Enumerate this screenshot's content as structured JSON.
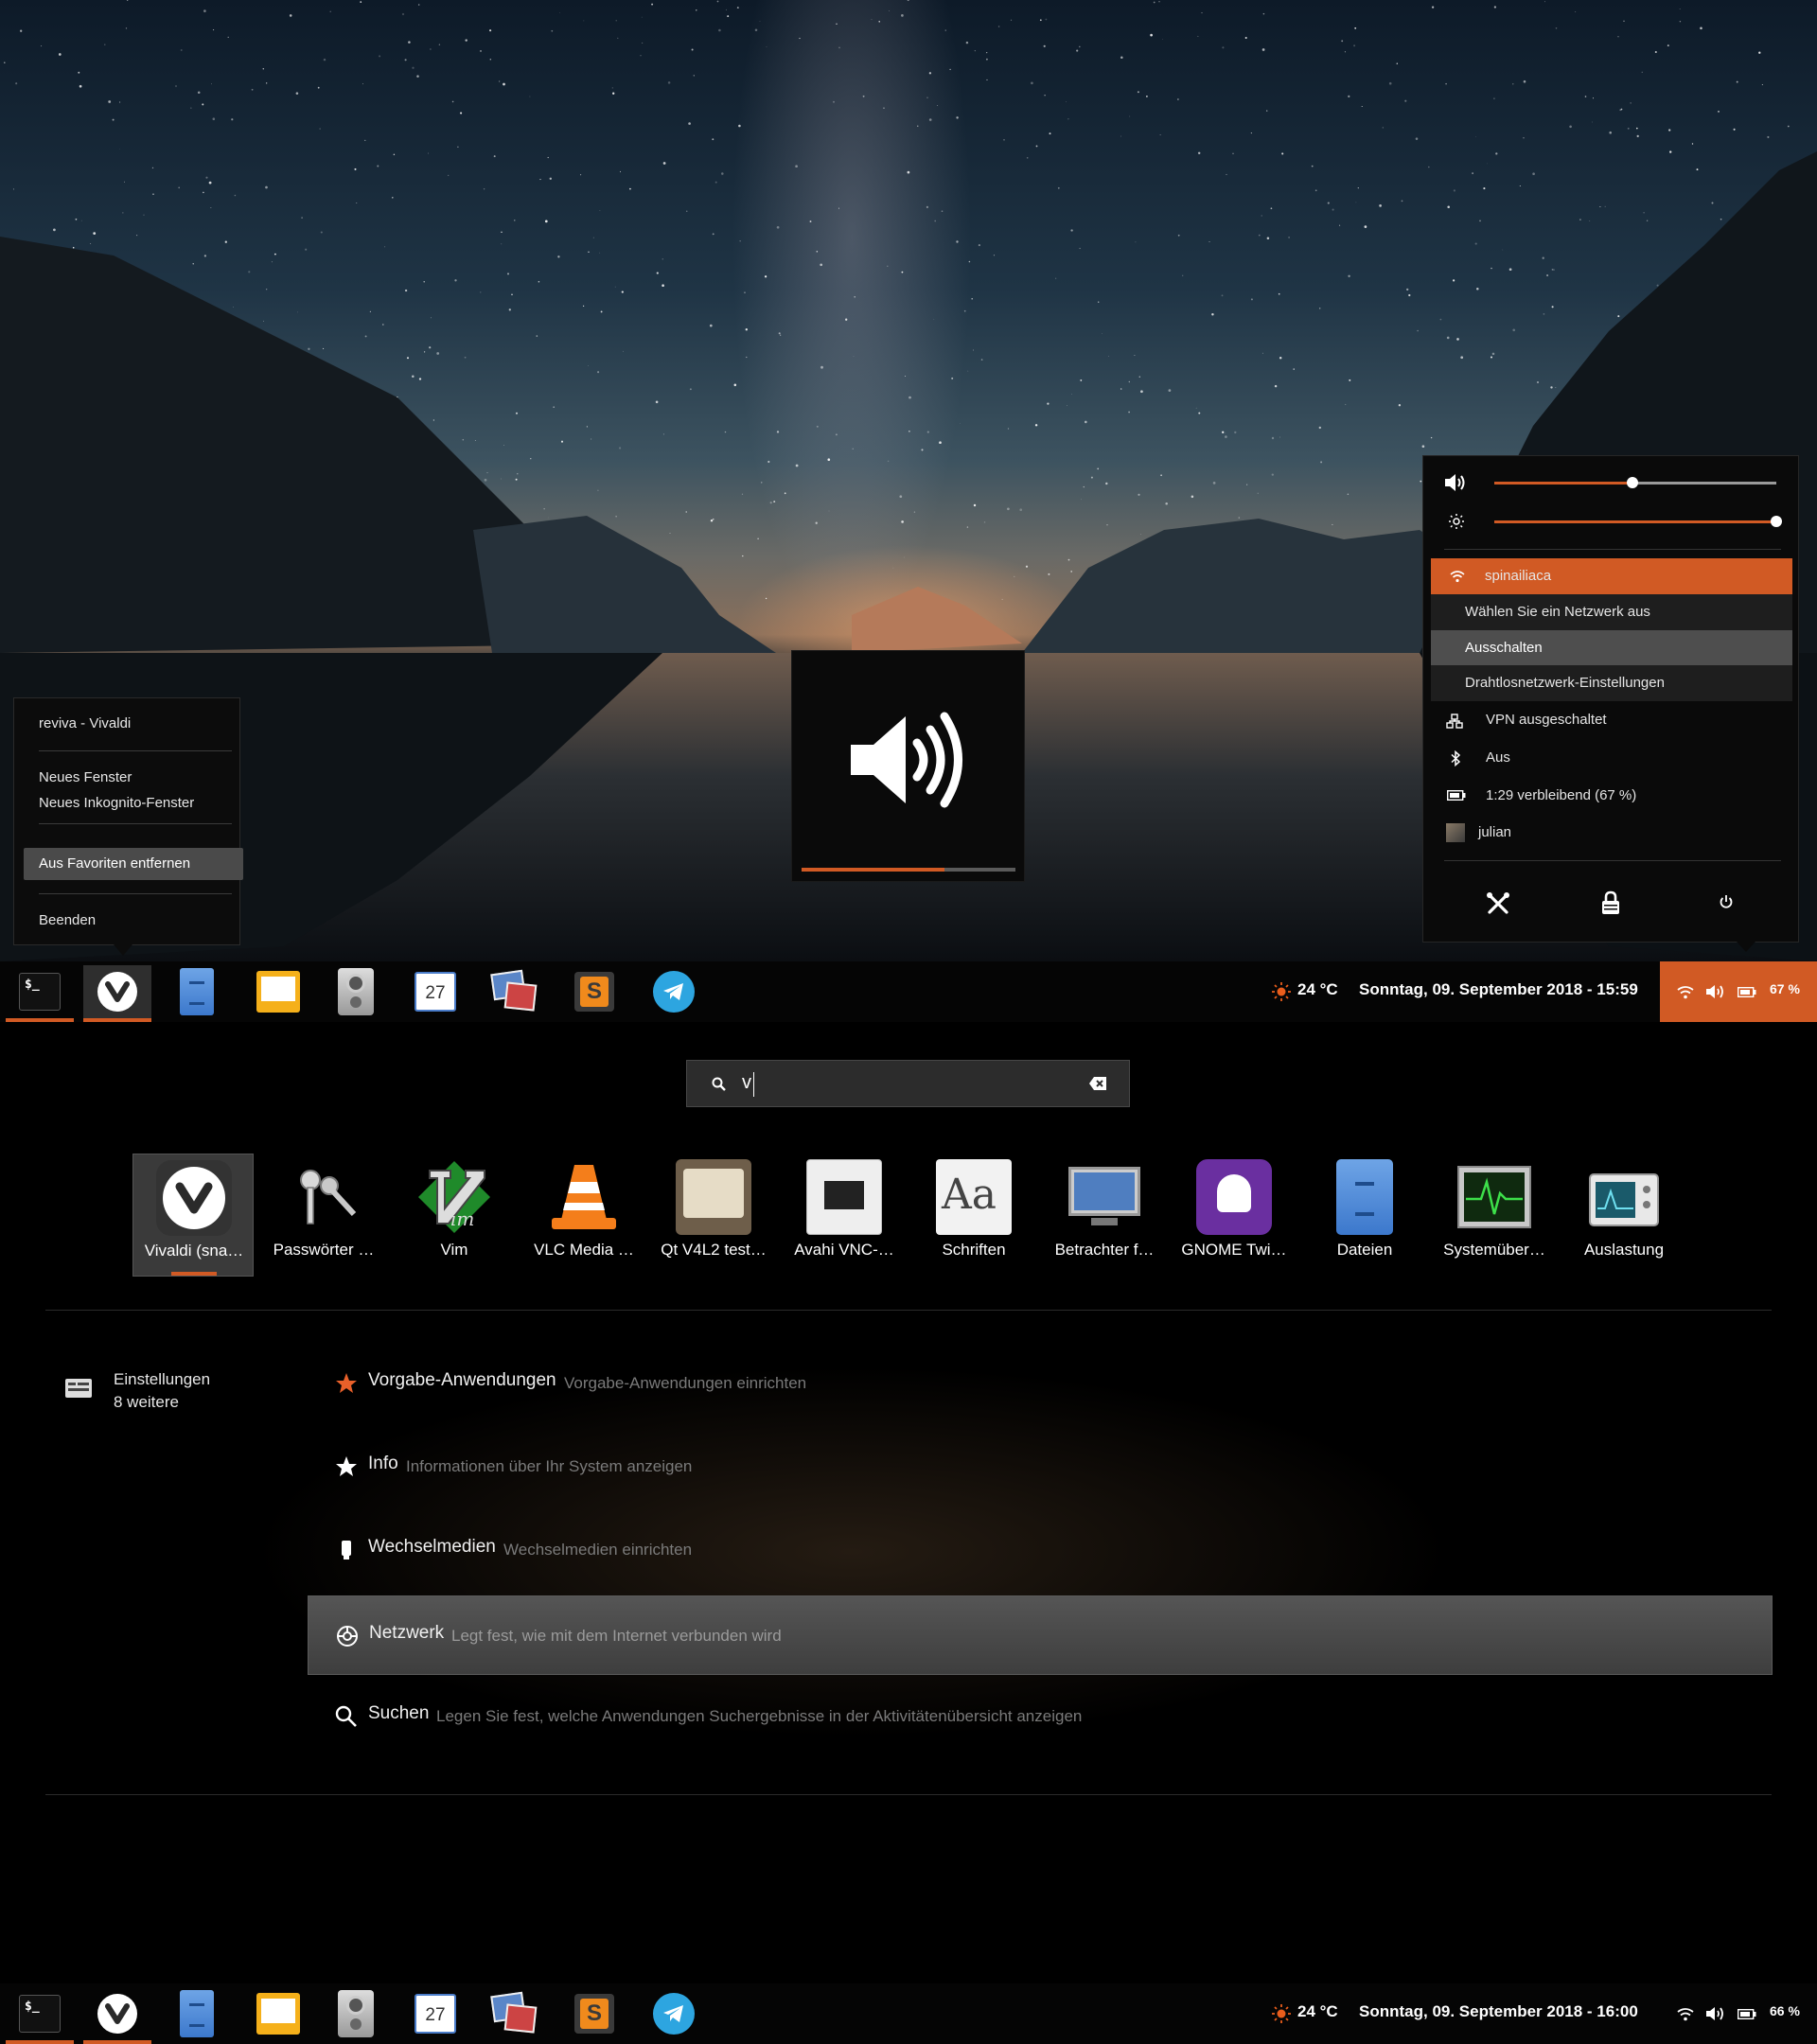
{
  "colors": {
    "accent": "#d15a24",
    "panel_bg": "#050505",
    "menu_bg": "#0a0a0a"
  },
  "desktop": {
    "vivaldi_menu": {
      "title": "reviva - Vivaldi",
      "items": [
        "Neues Fenster",
        "Neues Inkognito-Fenster"
      ],
      "highlighted": "Aus Favoriten entfernen",
      "quit": "Beenden"
    },
    "osd": {
      "icon": "speaker-volume-high-icon",
      "level": 0.67
    },
    "system_menu": {
      "volume_level": 0.49,
      "brightness_level": 1.0,
      "wifi": {
        "network": "spinailiaca",
        "items": [
          "Wählen Sie ein Netzwerk aus",
          "Ausschalten",
          "Drahtlosnetzwerk-Einstellungen"
        ]
      },
      "vpn": "VPN ausgeschaltet",
      "bluetooth": "Aus",
      "battery": "1:29 verbleibend (67 %)",
      "user": "julian",
      "actions": [
        "settings-icon",
        "lock-icon",
        "power-icon"
      ]
    }
  },
  "taskbar_top": {
    "apps": [
      "terminal",
      "vivaldi",
      "files",
      "slides",
      "speaker",
      "calendar",
      "image-viewer",
      "sublime",
      "telegram"
    ],
    "calendar_day": "27",
    "weather": "24 °C",
    "clock": "Sonntag, 09. September 2018 - 15:59",
    "battery_pct": "67 %"
  },
  "overview": {
    "search_value": "v",
    "apps": [
      {
        "name": "Vivaldi (sna…",
        "icon": "vivaldi-icon"
      },
      {
        "name": "Passwörter …",
        "icon": "keys-icon"
      },
      {
        "name": "Vim",
        "icon": "vim-icon"
      },
      {
        "name": "VLC Media …",
        "icon": "vlc-icon"
      },
      {
        "name": "Qt V4L2 test…",
        "icon": "tv-icon"
      },
      {
        "name": "Avahi VNC-…",
        "icon": "network-port-icon"
      },
      {
        "name": "Schriften",
        "icon": "fonts-icon"
      },
      {
        "name": "Betrachter f…",
        "icon": "monitor-icon"
      },
      {
        "name": "GNOME Twi…",
        "icon": "gnome-tweaks-icon"
      },
      {
        "name": "Dateien",
        "icon": "file-cabinet-icon"
      },
      {
        "name": "Systemüber…",
        "icon": "system-monitor-icon"
      },
      {
        "name": "Auslastung",
        "icon": "usage-icon"
      }
    ],
    "provider": {
      "name": "Einstellungen",
      "count": "8 weitere"
    },
    "results": [
      {
        "title": "Vorgabe-Anwendungen",
        "desc": "Vorgabe-Anwendungen einrichten",
        "icon": "star-orange-icon"
      },
      {
        "title": "Info",
        "desc": "Informationen über Ihr System anzeigen",
        "icon": "star-icon"
      },
      {
        "title": "Wechselmedien",
        "desc": "Wechselmedien einrichten",
        "icon": "removable-media-icon"
      },
      {
        "title": "Netzwerk",
        "desc": "Legt fest, wie mit dem Internet verbunden wird",
        "icon": "network-icon"
      },
      {
        "title": "Suchen",
        "desc": "Legen Sie fest, welche Anwendungen Suchergebnisse in der Aktivitätenübersicht anzeigen",
        "icon": "search-icon"
      }
    ]
  },
  "taskbar_bottom": {
    "calendar_day": "27",
    "weather": "24 °C",
    "clock": "Sonntag, 09. September 2018 - 16:00",
    "battery_pct": "66 %"
  }
}
